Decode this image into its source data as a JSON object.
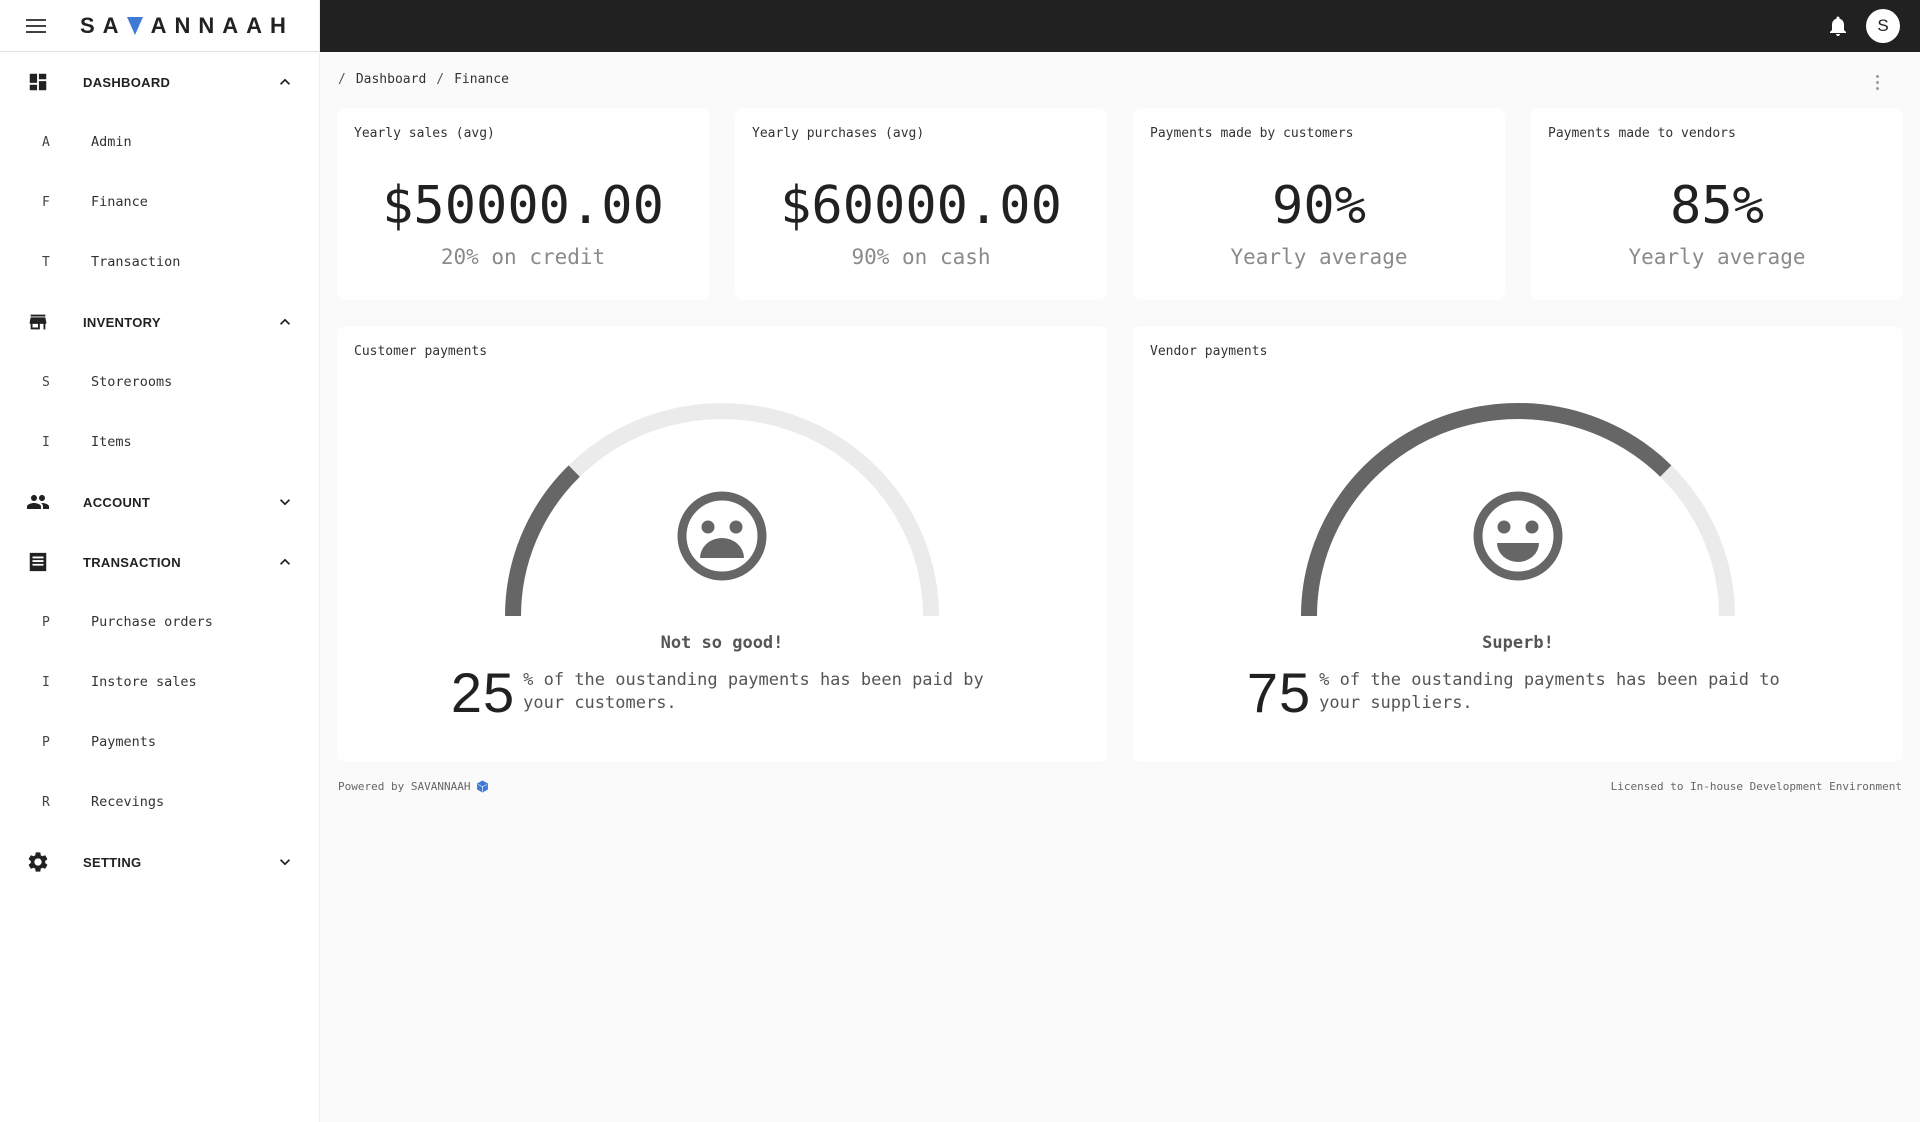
{
  "brand": {
    "name_pre": "SA",
    "name_post": "ANNAAH",
    "accent": "#3f7ad6"
  },
  "topbar": {
    "avatar_initial": "S",
    "notification_icon": "bell-icon"
  },
  "sidebar": {
    "groups": [
      {
        "label": "DASHBOARD",
        "icon": "dashboard-icon",
        "expanded": true,
        "items": [
          {
            "initial": "A",
            "label": "Admin"
          },
          {
            "initial": "F",
            "label": "Finance"
          },
          {
            "initial": "T",
            "label": "Transaction"
          }
        ]
      },
      {
        "label": "INVENTORY",
        "icon": "store-icon",
        "expanded": true,
        "items": [
          {
            "initial": "S",
            "label": "Storerooms"
          },
          {
            "initial": "I",
            "label": "Items"
          }
        ]
      },
      {
        "label": "ACCOUNT",
        "icon": "people-icon",
        "expanded": false,
        "items": []
      },
      {
        "label": "TRANSACTION",
        "icon": "receipt-icon",
        "expanded": true,
        "items": [
          {
            "initial": "P",
            "label": "Purchase orders"
          },
          {
            "initial": "I",
            "label": "Instore sales"
          },
          {
            "initial": "P",
            "label": "Payments"
          },
          {
            "initial": "R",
            "label": "Recevings"
          }
        ]
      },
      {
        "label": "SETTING",
        "icon": "gear-icon",
        "expanded": false,
        "items": []
      }
    ]
  },
  "breadcrumb": {
    "sep": "/",
    "items": [
      "Dashboard",
      "Finance"
    ]
  },
  "stats": [
    {
      "title": "Yearly sales (avg)",
      "value": "$50000.00",
      "sub": "20% on credit"
    },
    {
      "title": "Yearly purchases (avg)",
      "value": "$60000.00",
      "sub": "90% on cash"
    },
    {
      "title": "Payments made by customers",
      "value": "90%",
      "sub": "Yearly average"
    },
    {
      "title": "Payments made to vendors",
      "value": "85%",
      "sub": "Yearly average"
    }
  ],
  "gauges": [
    {
      "title": "Customer payments",
      "percent": 25,
      "mood": "sad",
      "verdict": "Not so good!",
      "big": "25",
      "desc": "% of the oustanding payments has been paid by your customers."
    },
    {
      "title": "Vendor payments",
      "percent": 75,
      "mood": "happy",
      "verdict": "Superb!",
      "big": "75",
      "desc": "% of the oustanding payments has been paid to your suppliers."
    }
  ],
  "colors": {
    "gauge_fill": "#666666",
    "gauge_track": "#ebebeb"
  },
  "footer": {
    "powered": "Powered by SAVANNAAH",
    "license": "Licensed to In-house Development Environment"
  }
}
